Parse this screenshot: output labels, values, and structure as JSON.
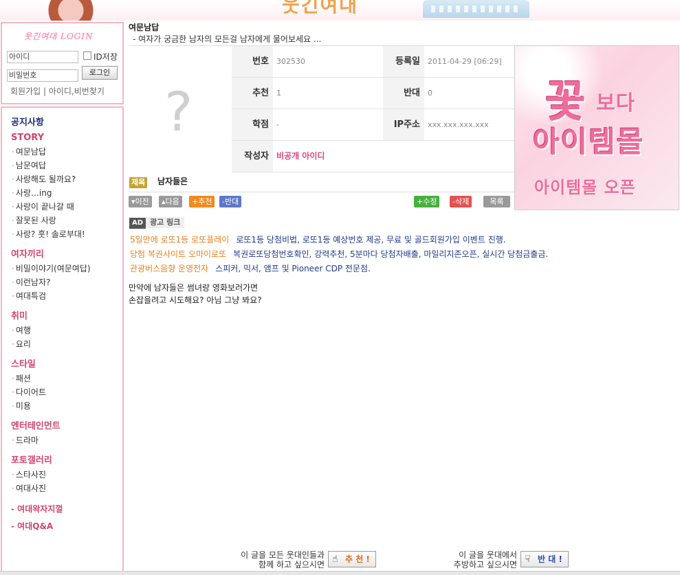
{
  "header": {
    "logo_text": "웃긴여대"
  },
  "login": {
    "title": "웃긴여대 LOGIN",
    "id_value": "아이디",
    "pw_value": "비밀번호",
    "save_id_label": "ID저장",
    "login_button": "로그인",
    "links": "회원가입 | 아이디,비번찾기"
  },
  "menu": {
    "notice": "공지사항",
    "story": {
      "heading": "STORY",
      "items": [
        "여문남답",
        "남문여답",
        "사랑해도 될까요?",
        "사랑…ing",
        "사랑이 끝나갈 때",
        "잘못된 사랑",
        "사랑? 훗! 솔로부대!"
      ]
    },
    "girls": {
      "heading": "여자끼리",
      "items": [
        "비밀이야기(여문여답)",
        "이런남자?",
        "여대특검"
      ]
    },
    "hobby": {
      "heading": "취미",
      "items": [
        "여행",
        "요리"
      ]
    },
    "style": {
      "heading": "스타일",
      "items": [
        "패션",
        "다이어트",
        "미용"
      ]
    },
    "entertain": {
      "heading": "엔터테인먼트",
      "items": [
        "드라마"
      ]
    },
    "photo": {
      "heading": "포토갤러리",
      "items": [
        "스타사진",
        "여대사진"
      ]
    },
    "extra1": "- 여대왁자지껄",
    "extra2": "- 여대Q&A"
  },
  "board": {
    "title": "여문남답",
    "subtitle": "-  여자가 궁금한 남자의 모든걸 남자에게 물어보세요 ..."
  },
  "post": {
    "avatar_placeholder": "?",
    "number_label": "번호",
    "number": "302530",
    "date_label": "등록일",
    "date": "2011-04-29 [06:29]",
    "recommend_label": "추천",
    "recommend": "1",
    "oppose_label": "반대",
    "oppose": "0",
    "school_label": "학점",
    "school": "-",
    "ip_label": "IP주소",
    "ip": "xxx.xxx.xxx.xxx",
    "author_label": "작성자",
    "author": "비공개 아이디",
    "subject_tag": "제목",
    "subject": "남자들은",
    "body": "만약에 남자들은 썸녀랑 영화보러가면\n손잡을려고 시도해요? 아님 그냥 봐요?"
  },
  "buttons": {
    "prev": "▾이전",
    "next": "▴다음",
    "recommend": "+추천",
    "oppose": "-반대",
    "edit": "+수정",
    "delete": "-삭제",
    "list": "목록"
  },
  "ad_banner": {
    "line1_big": "꽃",
    "line1_small": "보다",
    "line2": "아이템몰",
    "line3": "아이템몰 오픈"
  },
  "ad_links": {
    "badge": "AD",
    "label": "광고 링크",
    "items": [
      {
        "title": "5일만에 로또1등 로또플레이",
        "desc": "로또1등 당첨비법, 로또1등 예상번호 제공, 무료 및 골드회원가입 이벤트 진행."
      },
      {
        "title": "당첨 복권사이트 오마이로또",
        "desc": "복권로또당첨번호확인, 강력추천, 5분마다 당첨자배출, 마일리지존오픈, 실시간 당첨금출금."
      },
      {
        "title": "관광버스음향 운영전자",
        "desc": "스피커, 믹서, 앰프 및 Pioneer CDP 전문점."
      }
    ]
  },
  "recommend_area": {
    "up_text": "이 글을 모든 웃대인들과\n함께 하고 싶으시면",
    "up_button": "추 천 !",
    "down_text": "이 글을 웃대에서\n추방하고 싶으시면",
    "down_button": "반 대 !"
  }
}
